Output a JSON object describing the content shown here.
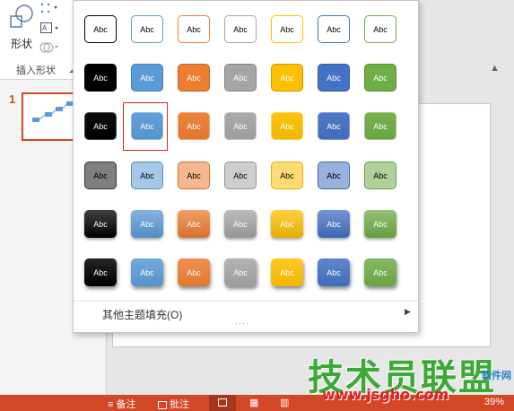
{
  "ribbon": {
    "shape_label": "形状",
    "group_label": "插入形状"
  },
  "thumbnails": {
    "slide_number": "1"
  },
  "gallery": {
    "swatch_text": "Abc",
    "more_fills_label": "其他主题填充(O)",
    "selected": {
      "row": 2,
      "col": 1
    },
    "theme_colors": [
      "#000000",
      "#5b9bd5",
      "#ed7d31",
      "#a5a5a5",
      "#ffc000",
      "#4472c4",
      "#70ad47"
    ],
    "row_styles": [
      "outline",
      "solid",
      "intense",
      "light",
      "gradient",
      "shadow"
    ]
  },
  "statusbar": {
    "notes": "备注",
    "comments": "批注",
    "zoom": "39%"
  },
  "watermark": {
    "title": "技术员联盟",
    "url": "www.jsgho.com",
    "small": "软件网"
  }
}
